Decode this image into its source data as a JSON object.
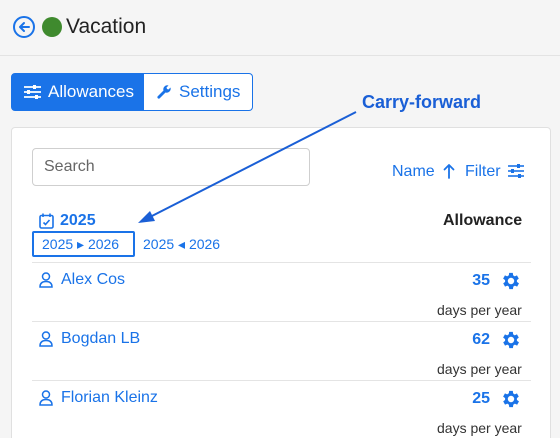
{
  "header": {
    "title": "Vacation",
    "status_color": "#3f8a2e",
    "back_icon": "arrow-left-circle-icon"
  },
  "tabs": [
    {
      "label": "Allowances",
      "icon": "sliders-icon",
      "active": true
    },
    {
      "label": "Settings",
      "icon": "wrench-icon",
      "active": false
    }
  ],
  "annotation": {
    "label": "Carry-forward",
    "color": "#1a5fd6"
  },
  "toolbar": {
    "search_placeholder": "Search",
    "sort_label": "Name",
    "sort_icon": "arrow-up-icon",
    "filter_label": "Filter",
    "filter_icon": "sliders-icon"
  },
  "year": {
    "label": "2025",
    "icon": "calendar-check-icon",
    "carry_forward": "2025 ▸ 2026",
    "carry_back": "2025 ◂ 2026"
  },
  "column": {
    "allowance_header": "Allowance"
  },
  "users": [
    {
      "name": "Alex Cos",
      "days": "35",
      "unit": "days per year"
    },
    {
      "name": "Bogdan LB",
      "days": "62",
      "unit": "days per year"
    },
    {
      "name": "Florian Kleinz",
      "days": "25",
      "unit": "days per year"
    }
  ],
  "colors": {
    "accent": "#1a73e8",
    "background": "#f5f5f5"
  }
}
